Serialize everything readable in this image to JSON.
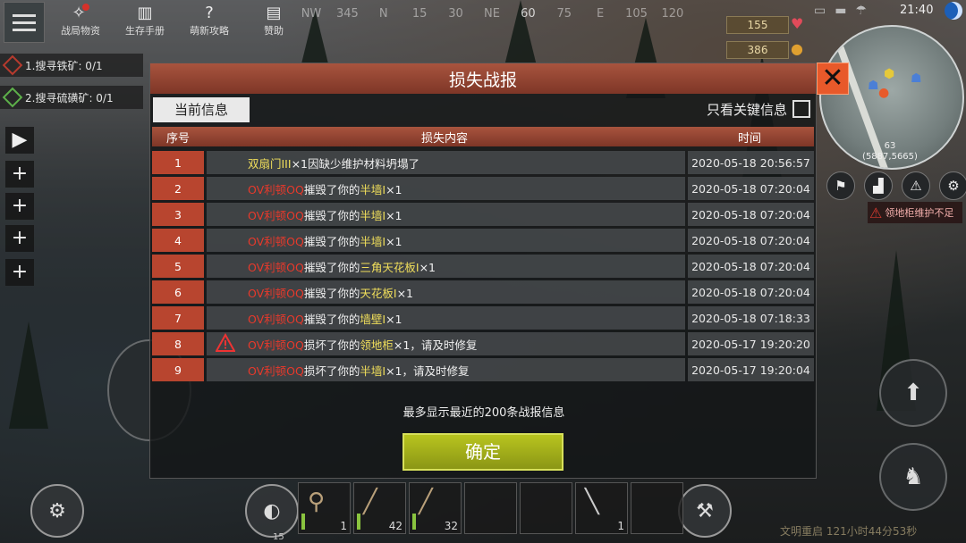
{
  "top_menu": {
    "items": [
      {
        "label": "战局物资",
        "icon": "party-popper-icon"
      },
      {
        "label": "生存手册",
        "icon": "book-icon"
      },
      {
        "label": "萌新攻略",
        "icon": "help-icon"
      },
      {
        "label": "赞助",
        "icon": "sponsor-icon"
      }
    ]
  },
  "compass": [
    "NW",
    "345",
    "N",
    "15",
    "30",
    "NE",
    "60",
    "75",
    "E",
    "105",
    "120"
  ],
  "resources": {
    "health": "155",
    "food": "386"
  },
  "clock": "21:40",
  "minimap": {
    "coords_line1": "63",
    "coords_line2": "(5887,5665)"
  },
  "warning_tag": "领地柜维护不足",
  "quests": [
    {
      "label": "1.搜寻铁矿: 0/1"
    },
    {
      "label": "2.搜寻硫磺矿: 0/1"
    }
  ],
  "dialog": {
    "title": "损失战报",
    "tab_current": "当前信息",
    "filter_label": "只看关键信息",
    "headers": {
      "index": "序号",
      "content": "损失内容",
      "time": "时间"
    },
    "rows": [
      {
        "index": "1",
        "actor": "",
        "verb": "",
        "item": "双扇门III",
        "rest": "×1因缺少维护材料坍塌了",
        "time": "2020-05-18 20:56:57",
        "warn": false
      },
      {
        "index": "2",
        "actor": "OV利顿OQ",
        "verb": "摧毁了你的",
        "item": "半墙I",
        "rest": "×1",
        "time": "2020-05-18 07:20:04",
        "warn": false
      },
      {
        "index": "3",
        "actor": "OV利顿OQ",
        "verb": "摧毁了你的",
        "item": "半墙I",
        "rest": "×1",
        "time": "2020-05-18 07:20:04",
        "warn": false
      },
      {
        "index": "4",
        "actor": "OV利顿OQ",
        "verb": "摧毁了你的",
        "item": "半墙I",
        "rest": "×1",
        "time": "2020-05-18 07:20:04",
        "warn": false
      },
      {
        "index": "5",
        "actor": "OV利顿OQ",
        "verb": "摧毁了你的",
        "item": "三角天花板I",
        "rest": "×1",
        "time": "2020-05-18 07:20:04",
        "warn": false
      },
      {
        "index": "6",
        "actor": "OV利顿OQ",
        "verb": "摧毁了你的",
        "item": "天花板I",
        "rest": "×1",
        "time": "2020-05-18 07:20:04",
        "warn": false
      },
      {
        "index": "7",
        "actor": "OV利顿OQ",
        "verb": "摧毁了你的",
        "item": "墙壁I",
        "rest": "×1",
        "time": "2020-05-18 07:18:33",
        "warn": false
      },
      {
        "index": "8",
        "actor": "OV利顿OQ",
        "verb": "损坏了你的",
        "item": "领地柜",
        "rest": "×1，请及时修复",
        "time": "2020-05-17 19:20:20",
        "warn": true
      },
      {
        "index": "9",
        "actor": "OV利顿OQ",
        "verb": "损坏了你的",
        "item": "半墙I",
        "rest": "×1，请及时修复",
        "time": "2020-05-17 19:20:04",
        "warn": false
      }
    ],
    "note": "最多显示最近的200条战报信息",
    "confirm": "确定"
  },
  "hotbar": {
    "slots": [
      {
        "qty": "1",
        "icon": "axe-icon"
      },
      {
        "qty": "42",
        "icon": "rifle-icon"
      },
      {
        "qty": "32",
        "icon": "rifle-icon"
      },
      {
        "qty": "",
        "icon": ""
      },
      {
        "qty": "",
        "icon": ""
      },
      {
        "qty": "1",
        "icon": "machete-icon"
      },
      {
        "qty": "",
        "icon": ""
      }
    ],
    "number": "15"
  },
  "footer": "文明重启 121小时44分53秒",
  "colors": {
    "header": "#a8543e",
    "index_cell": "#b8452f",
    "actor": "#e8392b",
    "item": "#f1df5b",
    "confirm": "#b8c41f",
    "close": "#e8592a"
  }
}
